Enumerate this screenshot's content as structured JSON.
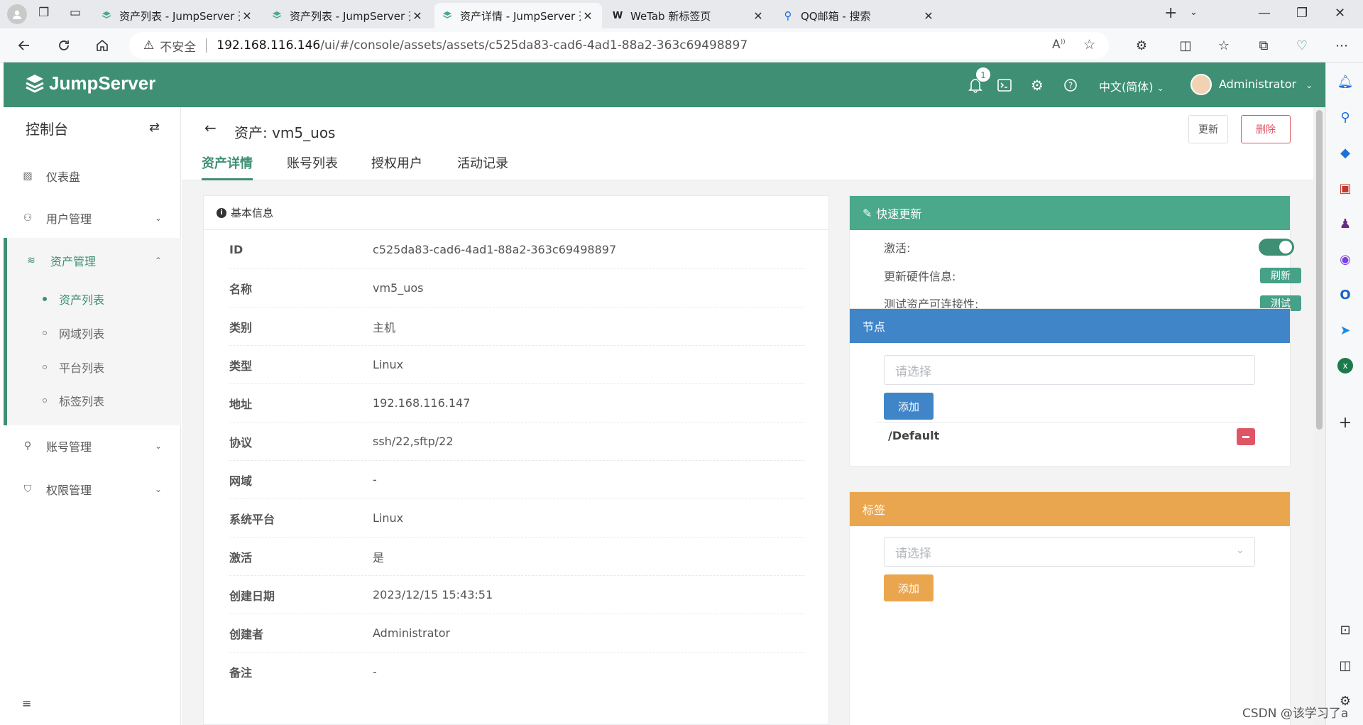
{
  "browser": {
    "tabs": [
      {
        "title": "资产列表 - JumpServer 开源堡垒",
        "active": false
      },
      {
        "title": "资产列表 - JumpServer 开源堡垒",
        "active": false
      },
      {
        "title": "资产详情 - JumpServer 开源堡垒",
        "active": true
      },
      {
        "title": "WeTab 新标签页",
        "active": false
      },
      {
        "title": "QQ邮箱 - 搜索",
        "active": false
      }
    ],
    "address": {
      "security_label": "不安全",
      "host": "192.168.116.146",
      "path": "/ui/#/console/assets/assets/c525da83-cad6-4ad1-88a2-363c69498897"
    }
  },
  "header": {
    "logo": "JumpServer",
    "notifications_count": "1",
    "language": "中文(简体)",
    "username": "Administrator",
    "accent_color": "#3e8f74"
  },
  "sidebar": {
    "title": "控制台",
    "items": [
      {
        "label": "仪表盘"
      },
      {
        "label": "用户管理"
      },
      {
        "label": "资产管理"
      },
      {
        "label": "账号管理"
      },
      {
        "label": "权限管理"
      }
    ],
    "asset_submenu": [
      {
        "label": "资产列表",
        "active": true
      },
      {
        "label": "网域列表",
        "active": false
      },
      {
        "label": "平台列表",
        "active": false
      },
      {
        "label": "标签列表",
        "active": false
      }
    ]
  },
  "page": {
    "title": "资产: vm5_uos",
    "update_button": "更新",
    "delete_button": "删除",
    "tabs": [
      "资产详情",
      "账号列表",
      "授权用户",
      "活动记录"
    ]
  },
  "basic_info": {
    "heading": "基本信息",
    "rows": [
      {
        "key": "ID",
        "value": "c525da83-cad6-4ad1-88a2-363c69498897"
      },
      {
        "key": "名称",
        "value": "vm5_uos"
      },
      {
        "key": "类别",
        "value": "主机"
      },
      {
        "key": "类型",
        "value": "Linux"
      },
      {
        "key": "地址",
        "value": "192.168.116.147"
      },
      {
        "key": "协议",
        "value": "ssh/22,sftp/22"
      },
      {
        "key": "网域",
        "value": "-"
      },
      {
        "key": "系统平台",
        "value": "Linux"
      },
      {
        "key": "激活",
        "value": "是"
      },
      {
        "key": "创建日期",
        "value": "2023/12/15 15:43:51"
      },
      {
        "key": "创建者",
        "value": "Administrator"
      },
      {
        "key": "备注",
        "value": "-"
      }
    ]
  },
  "quick_update": {
    "heading": "快速更新",
    "color": "#4aa98b",
    "active_label": "激活:",
    "active_on": true,
    "hardware_label": "更新硬件信息:",
    "refresh_button": "刷新",
    "connectivity_label": "测试资产可连接性:",
    "test_button": "测试"
  },
  "nodes": {
    "heading": "节点",
    "color": "#3f85c8",
    "placeholder": "请选择",
    "add_button": "添加",
    "items": [
      "/Default"
    ]
  },
  "labels": {
    "heading": "标签",
    "color": "#eaa64f",
    "placeholder": "请选择",
    "add_button": "添加"
  },
  "watermark": "CSDN @该学习了a"
}
